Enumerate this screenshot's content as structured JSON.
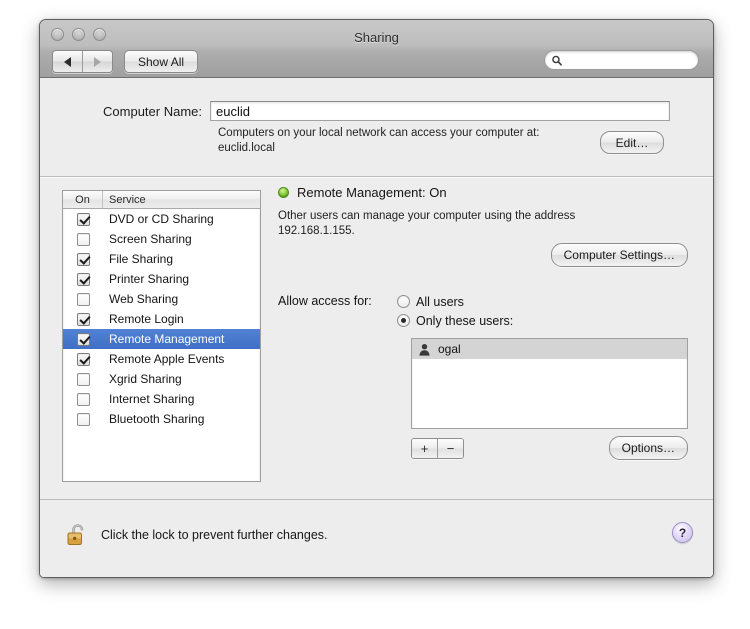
{
  "window": {
    "title": "Sharing",
    "traffic_lights": [
      "close",
      "minimize",
      "zoom"
    ]
  },
  "toolbar": {
    "back_label": "◀",
    "forward_label": "▶",
    "show_all_label": "Show All",
    "search": {
      "value": "",
      "placeholder": ""
    }
  },
  "computer_name": {
    "label": "Computer Name:",
    "value": "euclid",
    "note_line1": "Computers on your local network can access your computer at:",
    "note_line2": "euclid.local",
    "edit_label": "Edit…"
  },
  "services": {
    "columns": {
      "on": "On",
      "service": "Service"
    },
    "rows": [
      {
        "name": "DVD or CD Sharing",
        "checked": true,
        "selected": false
      },
      {
        "name": "Screen Sharing",
        "checked": false,
        "selected": false
      },
      {
        "name": "File Sharing",
        "checked": true,
        "selected": false
      },
      {
        "name": "Printer Sharing",
        "checked": true,
        "selected": false
      },
      {
        "name": "Web Sharing",
        "checked": false,
        "selected": false
      },
      {
        "name": "Remote Login",
        "checked": true,
        "selected": false
      },
      {
        "name": "Remote Management",
        "checked": true,
        "selected": true
      },
      {
        "name": "Remote Apple Events",
        "checked": true,
        "selected": false
      },
      {
        "name": "Xgrid Sharing",
        "checked": false,
        "selected": false
      },
      {
        "name": "Internet Sharing",
        "checked": false,
        "selected": false
      },
      {
        "name": "Bluetooth Sharing",
        "checked": false,
        "selected": false
      }
    ]
  },
  "detail": {
    "status_title": "Remote Management: On",
    "status_color": "#6fbb2e",
    "description_line1": "Other users can manage your computer using the address",
    "description_line2": "192.168.1.155.",
    "computer_settings_label": "Computer Settings…",
    "access": {
      "label": "Allow access for:",
      "options": [
        {
          "label": "All users",
          "selected": false
        },
        {
          "label": "Only these users:",
          "selected": true
        }
      ],
      "users": [
        {
          "name": "ogal",
          "selected": true
        }
      ],
      "add_label": "+",
      "remove_label": "−",
      "options_button_label": "Options…"
    }
  },
  "footer": {
    "lock_text": "Click the lock to prevent further changes.",
    "lock_state": "unlocked",
    "help_label": "?"
  }
}
